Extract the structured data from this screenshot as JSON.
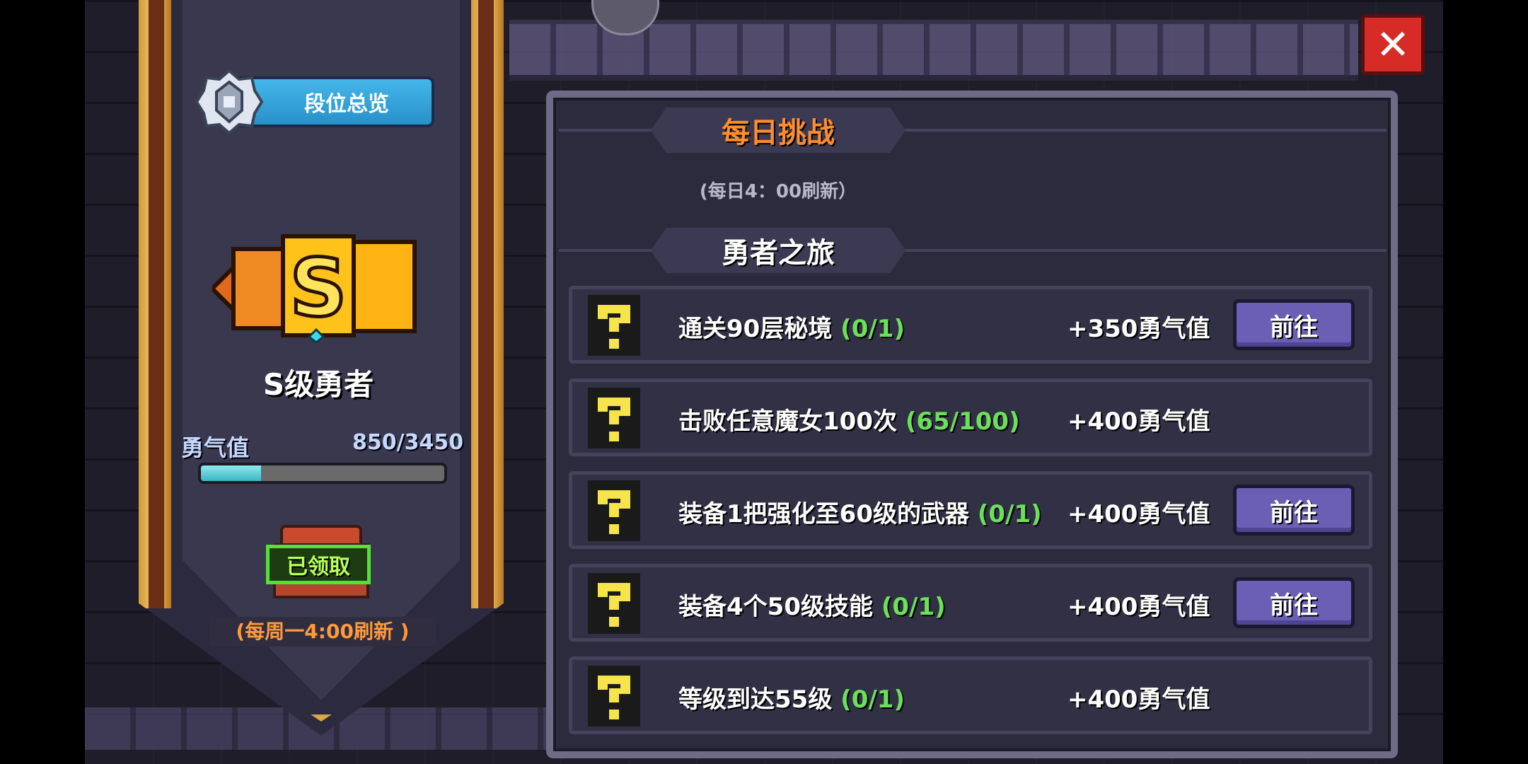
{
  "left_panel": {
    "rank_overview_label": "段位总览",
    "rank_name": "S级勇者",
    "courage_label": "勇气值",
    "courage_value": "850/3450",
    "courage_progress": 0.246,
    "claimed_label": "已领取",
    "weekly_refresh": "(每周一4:00刷新 )"
  },
  "close_icon": "close-icon",
  "panel": {
    "title": "每日挑战",
    "refresh_note": "(每日4：00刷新）",
    "section_title": "勇者之旅",
    "quests": [
      {
        "title": "通关90层秘境",
        "progress": "(0/1)",
        "reward": "+350勇气值",
        "button": "前往"
      },
      {
        "title": "击败任意魔女100次",
        "progress": "(65/100)",
        "reward": "+400勇气值",
        "button": ""
      },
      {
        "title": "装备1把强化至60级的武器",
        "progress": "(0/1)",
        "reward": "+400勇气值",
        "button": "前往"
      },
      {
        "title": "装备4个50级技能",
        "progress": "(0/1)",
        "reward": "+400勇气值",
        "button": "前往"
      },
      {
        "title": "等级到达55级",
        "progress": "(0/1)",
        "reward": "+400勇气值",
        "button": ""
      }
    ]
  },
  "colors": {
    "accent_orange": "#ff8d2a",
    "progress_green": "#6be05a",
    "button_purple": "#6a5fb4",
    "close_red": "#d62b26"
  }
}
